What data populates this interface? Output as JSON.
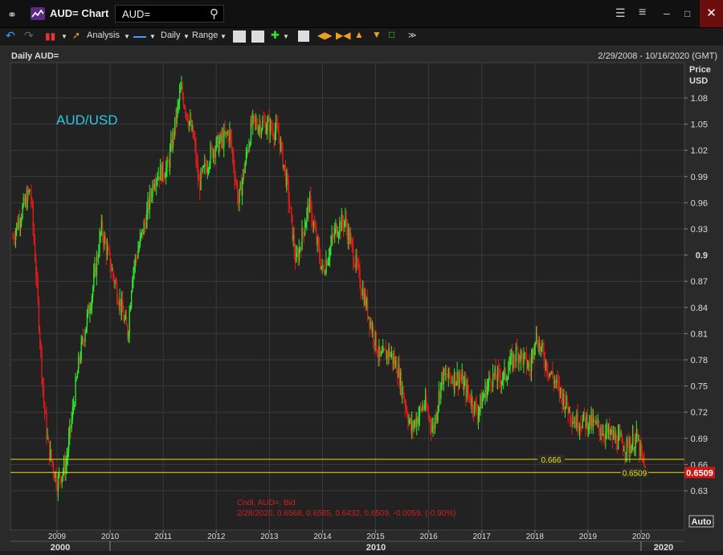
{
  "window": {
    "title": "AUD= Chart",
    "search_value": "AUD=",
    "icons": {
      "link": "link-icon",
      "app": "chart-app-icon",
      "search": "search-icon",
      "layout": "tree-layout-icon",
      "menu": "hamburger-menu-icon",
      "minimize": "minimize-icon",
      "maximize": "maximize-icon",
      "close": "close-icon"
    }
  },
  "toolbar": {
    "analysis": "Analysis",
    "daily": "Daily",
    "range": "Range"
  },
  "chart_header": {
    "left": "Daily AUD=",
    "right": "2/29/2008 - 10/16/2020 (GMT)"
  },
  "overlay_label": "AUD/USD",
  "price_axis": {
    "title1": "Price",
    "title2": "USD"
  },
  "auto_button": "Auto",
  "readout": {
    "line1": "Cndl, AUD=, Bid",
    "line2": "2/28/2020, 0.6568, 0.6585, 0.6432, 0.6509, -0.0059, (-0.90%)"
  },
  "hlines": [
    {
      "label": "0.666",
      "value": 0.666
    },
    {
      "label": "0.6509",
      "value": 0.6509
    }
  ],
  "last_price": "0.6509",
  "colors": {
    "up": "#2ee82e",
    "down": "#e21b1b",
    "bg": "#2a2a2a",
    "grid": "#3a3a3a",
    "hline": "#e8e000",
    "accent": "#2fc6e6"
  },
  "chart_data": {
    "type": "line",
    "title": "",
    "xlabel": "",
    "ylabel": "Price USD",
    "ylim": [
      0.6,
      1.12
    ],
    "y_ticks": [
      "0.63",
      "0.66",
      "0.69",
      "0.72",
      "0.75",
      "0.78",
      "0.81",
      "0.84",
      "0.87",
      "0.9",
      "0.93",
      "0.96",
      "0.99",
      "1.02",
      "1.05",
      "1.08"
    ],
    "x_ticks": [
      "2009",
      "2010",
      "2011",
      "2012",
      "2013",
      "2014",
      "2015",
      "2016",
      "2017",
      "2018",
      "2019",
      "2020"
    ],
    "decade_labels": [
      "2000",
      "2010",
      "2020"
    ],
    "series": [
      {
        "name": "AUD= Bid",
        "x": [
          "2008-03",
          "2008-05",
          "2008-07",
          "2008-08",
          "2008-10",
          "2008-11",
          "2009-01",
          "2009-03",
          "2009-06",
          "2009-09",
          "2009-11",
          "2010-02",
          "2010-05",
          "2010-06",
          "2010-09",
          "2010-11",
          "2011-02",
          "2011-04",
          "2011-05",
          "2011-08",
          "2011-09",
          "2011-12",
          "2012-04",
          "2012-06",
          "2012-09",
          "2012-12",
          "2013-03",
          "2013-05",
          "2013-07",
          "2013-10",
          "2014-01",
          "2014-04",
          "2014-06",
          "2014-09",
          "2014-12",
          "2015-02",
          "2015-04",
          "2015-06",
          "2015-09",
          "2015-12",
          "2016-02",
          "2016-04",
          "2016-08",
          "2016-12",
          "2017-03",
          "2017-06",
          "2017-09",
          "2017-12",
          "2018-01",
          "2018-04",
          "2018-07",
          "2018-10",
          "2019-01",
          "2019-04",
          "2019-07",
          "2019-10",
          "2019-12",
          "2020-02"
        ],
        "values": [
          0.92,
          0.95,
          0.975,
          0.9,
          0.73,
          0.68,
          0.64,
          0.66,
          0.78,
          0.86,
          0.93,
          0.87,
          0.81,
          0.88,
          0.94,
          0.99,
          1.0,
          1.06,
          1.09,
          1.03,
          0.98,
          1.02,
          1.04,
          0.96,
          1.05,
          1.05,
          1.04,
          0.98,
          0.89,
          0.96,
          0.88,
          0.93,
          0.94,
          0.88,
          0.82,
          0.78,
          0.79,
          0.77,
          0.7,
          0.73,
          0.7,
          0.76,
          0.76,
          0.72,
          0.76,
          0.76,
          0.79,
          0.77,
          0.81,
          0.77,
          0.74,
          0.71,
          0.71,
          0.7,
          0.69,
          0.68,
          0.69,
          0.6509
        ]
      }
    ],
    "grid": true,
    "last_value": 0.6509
  }
}
